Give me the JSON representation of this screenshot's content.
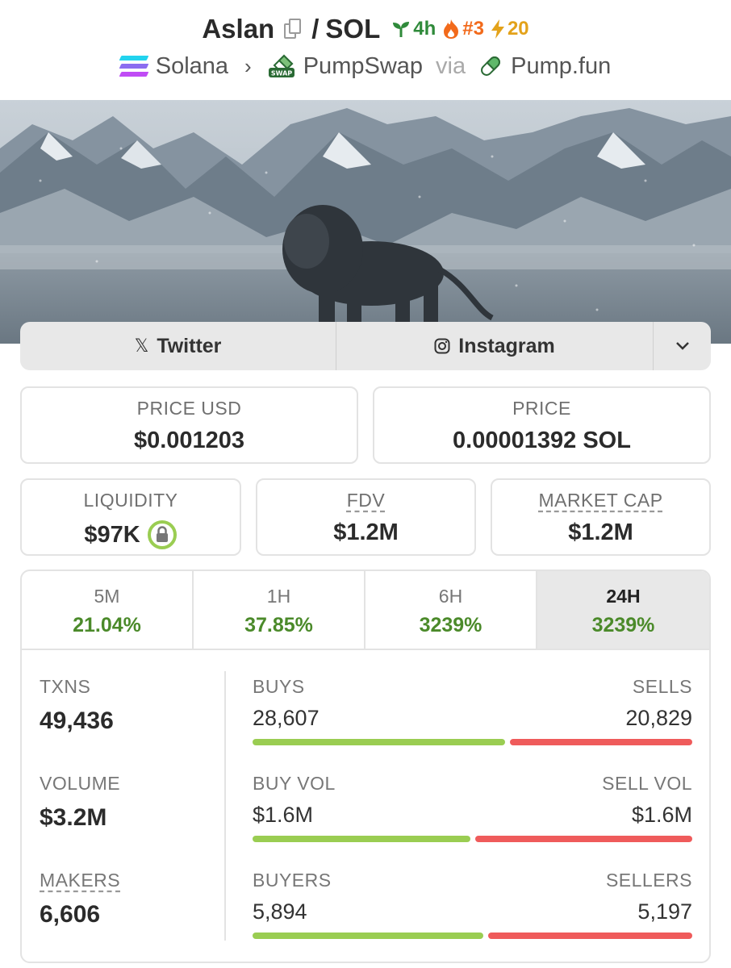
{
  "header": {
    "token": "Aslan",
    "quote": "SOL",
    "age_badge": "4h",
    "rank_badge": "#3",
    "boost_badge": "20",
    "colors": {
      "age": "#2f8a3a",
      "rank": "#f26a1b",
      "boost": "#e3a21a"
    }
  },
  "breadcrumb": {
    "chain": "Solana",
    "dex": "PumpSwap",
    "dex_icon_text": "SWAP",
    "via": "via",
    "launchpad": "Pump.fun"
  },
  "socials": {
    "twitter": "Twitter",
    "instagram": "Instagram"
  },
  "prices": {
    "price_usd_label": "PRICE USD",
    "price_usd": "$0.001203",
    "price_label": "PRICE",
    "price_native": "0.00001392 SOL"
  },
  "market": {
    "liquidity_label": "LIQUIDITY",
    "liquidity": "$97K",
    "fdv_label": "FDV",
    "fdv": "$1.2M",
    "mcap_label": "MARKET CAP",
    "mcap": "$1.2M"
  },
  "timeframes": [
    {
      "label": "5M",
      "change": "21.04%",
      "active": false
    },
    {
      "label": "1H",
      "change": "37.85%",
      "active": false
    },
    {
      "label": "6H",
      "change": "3239%",
      "active": false
    },
    {
      "label": "24H",
      "change": "3239%",
      "active": true
    }
  ],
  "stats": {
    "txns_label": "TXNS",
    "txns": "49,436",
    "volume_label": "VOLUME",
    "volume": "$3.2M",
    "makers_label": "MAKERS",
    "makers": "6,606",
    "buys_label": "BUYS",
    "buys": "28,607",
    "sells_label": "SELLS",
    "sells": "20,829",
    "buy_vol_label": "BUY VOL",
    "buy_vol": "$1.6M",
    "sell_vol_label": "SELL VOL",
    "sell_vol": "$1.6M",
    "buyers_label": "BUYERS",
    "buyers": "5,894",
    "sellers_label": "SELLERS",
    "sellers": "5,197",
    "ratios": {
      "buys": 0.579,
      "buy_vol": 0.5,
      "buyers": 0.531
    },
    "colors": {
      "buy": "#9acd52",
      "sell": "#ef5b5b",
      "positive": "#4b8a2a"
    }
  }
}
